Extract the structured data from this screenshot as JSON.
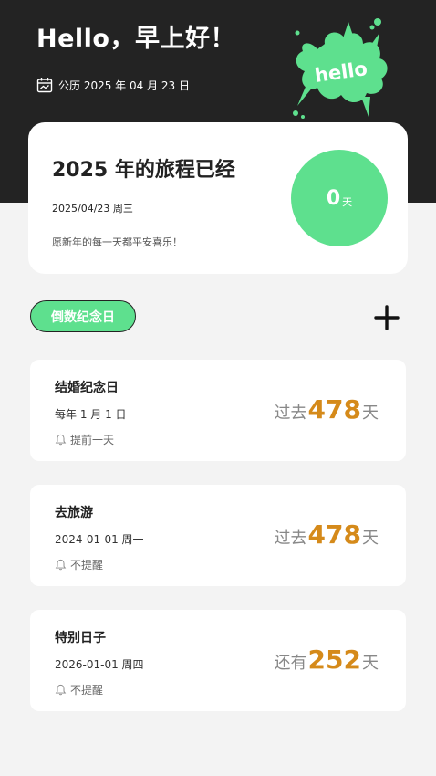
{
  "header": {
    "greeting": "Hello，早上好！",
    "date_text": "公历 2025 年 04 月 23 日",
    "splash_text": "hello"
  },
  "summary": {
    "title": "2025 年的旅程已经",
    "date": "2025/04/23 周三",
    "wish": "愿新年的每一天都平安喜乐！",
    "days_value": "0",
    "days_unit": "天"
  },
  "section": {
    "tag_label": "倒数纪念日"
  },
  "events": [
    {
      "name": "结婚纪念日",
      "date": "每年 1 月 1 日",
      "remind": "提前一天",
      "prefix": "过去",
      "days": "478",
      "unit": "天"
    },
    {
      "name": "去旅游",
      "date": "2024-01-01 周一",
      "remind": "不提醒",
      "prefix": "过去",
      "days": "478",
      "unit": "天"
    },
    {
      "name": "特别日子",
      "date": "2026-01-01 周四",
      "remind": "不提醒",
      "prefix": "还有",
      "days": "252",
      "unit": "天"
    }
  ],
  "colors": {
    "accent_green": "#5ee08e",
    "header_dark": "#232323",
    "count_orange": "#d58a1a"
  }
}
